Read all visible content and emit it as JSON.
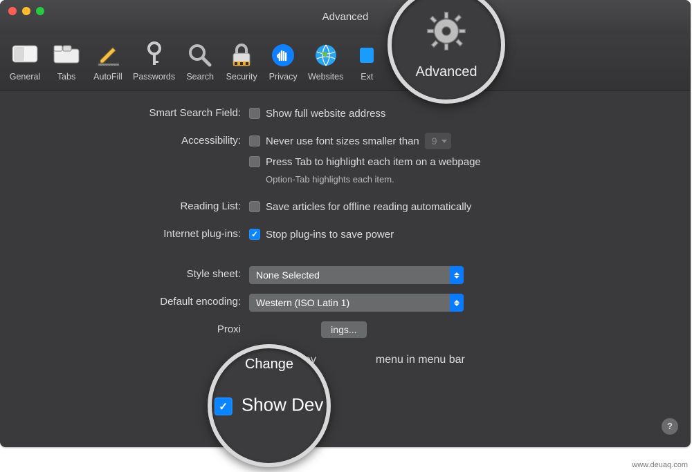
{
  "window": {
    "title": "Advanced"
  },
  "toolbar": {
    "items": [
      {
        "label": "General"
      },
      {
        "label": "Tabs"
      },
      {
        "label": "AutoFill"
      },
      {
        "label": "Passwords"
      },
      {
        "label": "Search"
      },
      {
        "label": "Security"
      },
      {
        "label": "Privacy"
      },
      {
        "label": "Websites"
      },
      {
        "label": "Ext"
      },
      {
        "label": "Advanced"
      }
    ]
  },
  "labels": {
    "smart_search": "Smart Search Field:",
    "accessibility": "Accessibility:",
    "reading_list": "Reading List:",
    "plugins": "Internet plug-ins:",
    "stylesheet": "Style sheet:",
    "encoding": "Default encoding:",
    "proxies": "Proxi"
  },
  "options": {
    "show_full_address": "Show full website address",
    "never_font_smaller": "Never use font sizes smaller than",
    "font_size_value": "9",
    "press_tab": "Press Tab to highlight each item on a webpage",
    "option_tab_hint": "Option-Tab highlights each item.",
    "save_articles": "Save articles for offline reading automatically",
    "stop_plugins": "Stop plug-ins to save power",
    "stylesheet_value": "None Selected",
    "encoding_value": "Western (ISO Latin 1)",
    "proxies_button_fragment": "ings...",
    "show_develop_prefix": "Show Dev",
    "show_develop_suffix": "menu in menu bar"
  },
  "magnifier": {
    "advanced_label": "Advanced",
    "change_fragment": "Change"
  },
  "watermark": "www.deuaq.com"
}
